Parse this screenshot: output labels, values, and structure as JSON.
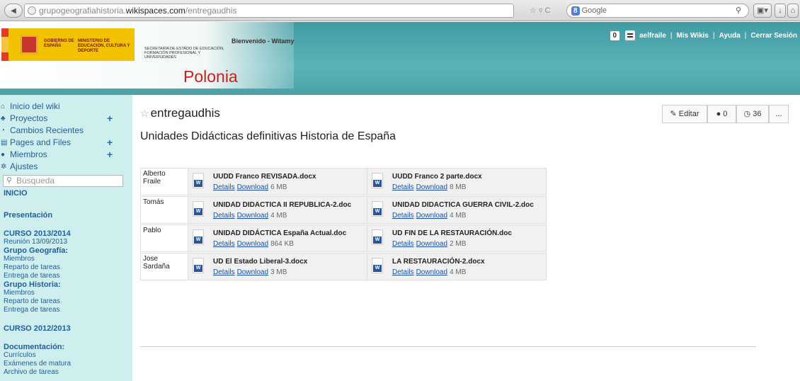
{
  "browser": {
    "back_icon": "back-arrow-icon",
    "url_host": "grupogeografiahistoria.",
    "url_domain": "wikispaces.com",
    "url_path": "/entregaudhis",
    "star_reload": "☆ ▿ C",
    "search_engine_badge": "8",
    "search_placeholder": "Google",
    "search_icon": "magnifier-icon"
  },
  "header": {
    "gov_line1": "GOBIERNO DE ESPAÑA",
    "gov_line2": "MINISTERIO DE EDUCACIÓN, CULTURA Y DEPORTE",
    "secretaria": "SECRETARÍA DE ESTADO DE EDUCACIÓN, FORMACIÓN PROFESIONAL Y UNIVERSIDADES",
    "welcome": "Bienvenido - Witamy",
    "site_title": "Polonia"
  },
  "userbar": {
    "count": "0",
    "username": "aelfraile",
    "links": [
      "Mis Wikis",
      "Ayuda",
      "Cerrar Sesión"
    ]
  },
  "sidebar": {
    "items": [
      {
        "label": "Inicio del wiki",
        "icon": "home-icon",
        "plus": false
      },
      {
        "label": "Proyectos",
        "icon": "project-icon",
        "plus": true
      },
      {
        "label": "Cambios Recientes",
        "icon": "clock-icon",
        "plus": false
      },
      {
        "label": "Pages and Files",
        "icon": "page-icon",
        "plus": true
      },
      {
        "label": "Miembros",
        "icon": "user-icon",
        "plus": true
      },
      {
        "label": "Ajustes",
        "icon": "gear-icon",
        "plus": false
      }
    ],
    "search_placeholder": "Búsqueda",
    "nav": {
      "inicio": "INICIO",
      "presentacion": "Presentación",
      "curso_2013": "CURSO 2013/2014",
      "reunion": "Reunión 13/09/2013",
      "grupo_geo": "Grupo Geografía:",
      "geo_links": [
        "Miembros",
        "Reparto de tareas",
        "Entrega de tareas"
      ],
      "grupo_hist": "Grupo Historia:",
      "hist_links": [
        "Miembros",
        "Reparto de tareas",
        "Entrega de tareas"
      ],
      "curso_2012": "CURSO 2012/2013",
      "documentacion": "Documentación:",
      "doc_links": [
        "Currículos",
        "Exámenes de matura",
        "Archivo de tareas"
      ]
    }
  },
  "page": {
    "title": "entregaudhis",
    "subtitle": "Unidades Didácticas definitivas Historia de España",
    "edit_label": "Editar",
    "comments_count": "0",
    "history_count": "36",
    "more_label": "..."
  },
  "files": {
    "details_label": "Details",
    "download_label": "Download",
    "rows": [
      {
        "person": "Alberto Fraile",
        "a": {
          "name": "UUDD Franco REVISADA.docx",
          "size": "6 MB"
        },
        "b": {
          "name": "UUDD Franco 2 parte.docx",
          "size": "8 MB"
        }
      },
      {
        "person": "Tomás",
        "a": {
          "name": "UNIDAD DIDACTICA II REPUBLICA-2.doc",
          "size": "4 MB"
        },
        "b": {
          "name": "UNIDAD DIDACTICA GUERRA CIVIL-2.doc",
          "size": "4 MB"
        }
      },
      {
        "person": "Pablo",
        "a": {
          "name": "UNIDAD DIDÁCTICA España Actual.doc",
          "size": "864 KB"
        },
        "b": {
          "name": "UD FIN DE LA RESTAURACIÓN.doc",
          "size": "2 MB"
        }
      },
      {
        "person": "Jose Sardaña",
        "a": {
          "name": "UD El Estado Liberal-3.docx",
          "size": "3 MB"
        },
        "b": {
          "name": "LA RESTAURACIÓN-2.docx",
          "size": "4 MB"
        }
      }
    ]
  }
}
